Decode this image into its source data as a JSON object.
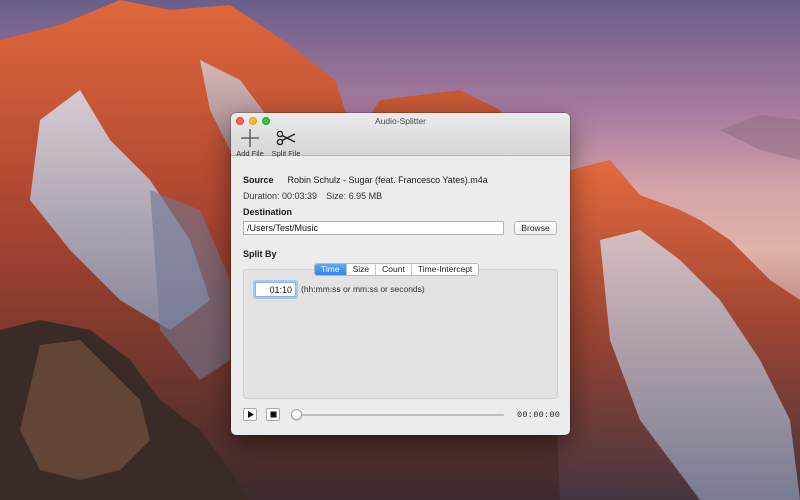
{
  "desktop": {
    "wallpaper": "mountain-sunset"
  },
  "window": {
    "title": "Audio-Splitter",
    "toolbar": {
      "add_file_label": "Add File",
      "split_file_label": "Split File"
    }
  },
  "source": {
    "label": "Source",
    "filename": "Robin Schulz - Sugar (feat. Francesco Yates).m4a",
    "duration_text": "Duration: 00:03:39",
    "size_text": "Size: 6.95 MB"
  },
  "destination": {
    "label": "Destination",
    "path": "/Users/Test/Music",
    "browse_label": "Browse"
  },
  "split_by": {
    "label": "Split By",
    "tabs": [
      "Time",
      "Size",
      "Count",
      "Time-Intercept"
    ],
    "active_tab": "Time",
    "time_value": "01:10",
    "time_hint": "(hh:mm:ss or mm:ss or seconds)"
  },
  "player": {
    "position_fraction": 0,
    "time_readout": "00:00:00"
  },
  "colors": {
    "accent": "#2d85ec",
    "close": "#fc5f57",
    "minimize": "#fdbc2e",
    "maximize": "#33c748"
  }
}
